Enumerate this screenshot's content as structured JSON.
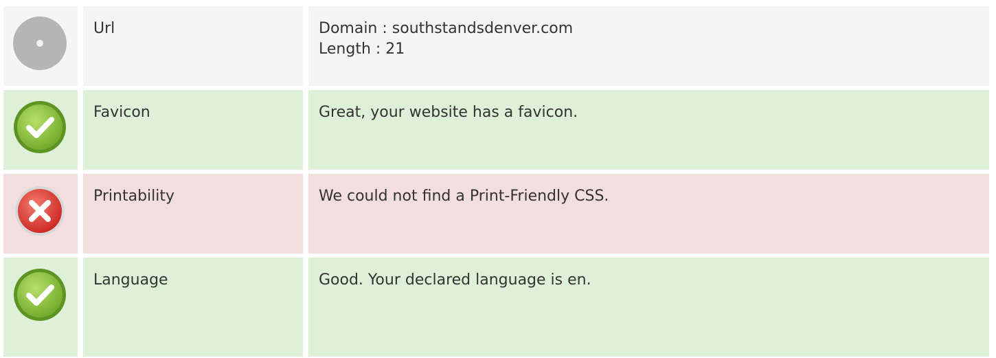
{
  "rows": [
    {
      "status": "neutral",
      "icon": "neutral-circle-icon",
      "label": "Url",
      "lines": [
        "Domain : southstandsdenver.com",
        "Length : 21"
      ]
    },
    {
      "status": "pass",
      "icon": "checkmark-icon",
      "label": "Favicon",
      "lines": [
        "Great, your website has a favicon."
      ]
    },
    {
      "status": "fail",
      "icon": "cross-icon",
      "label": "Printability",
      "lines": [
        "We could not find a Print-Friendly CSS."
      ]
    },
    {
      "status": "pass",
      "icon": "checkmark-icon",
      "label": "Language",
      "lines": [
        "Good. Your declared language is en."
      ]
    }
  ],
  "colors": {
    "neutral_bg": "#f5f5f5",
    "pass_bg": "#dff0d8",
    "fail_bg": "#f2dede",
    "pass_icon": "#8dc63f",
    "fail_icon": "#e2403e",
    "neutral_icon": "#b5b5b5"
  }
}
